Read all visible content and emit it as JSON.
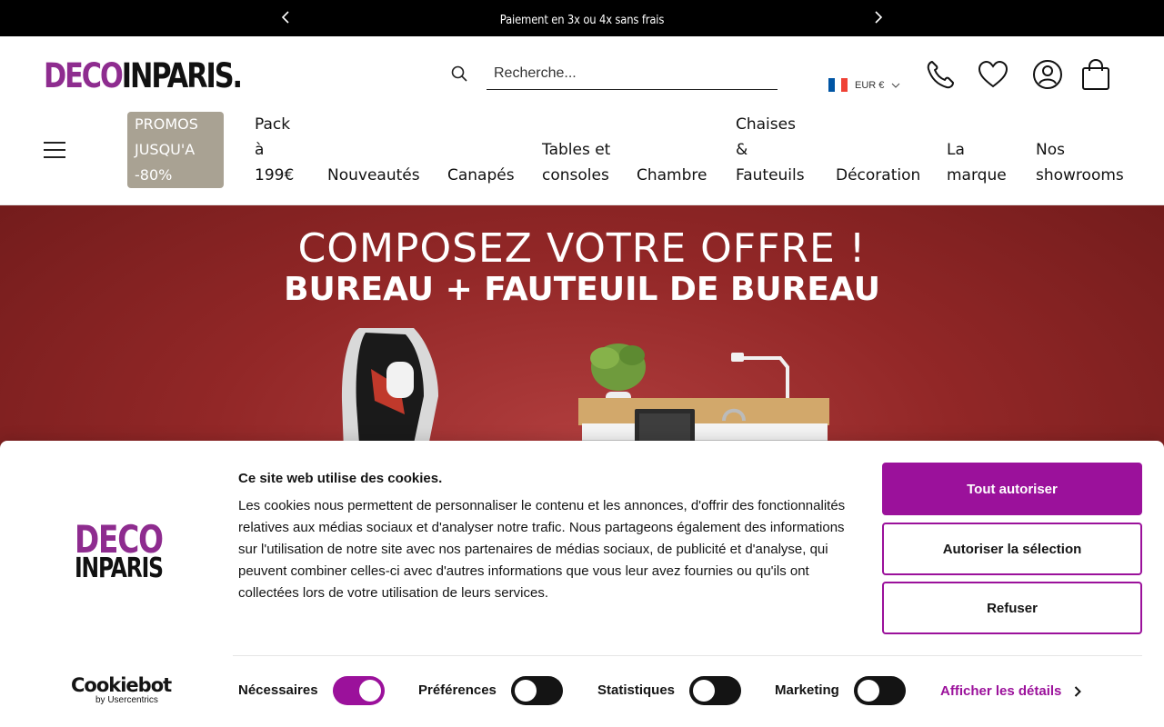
{
  "announcement": {
    "message": "Paiement en 3x ou 4x sans frais",
    "prev_icon": "chevron-left-icon",
    "next_icon": "chevron-right-icon"
  },
  "header": {
    "logo": {
      "part1": "DECO",
      "part2": "INPARIS",
      "dot": "."
    },
    "search": {
      "placeholder": "Recherche...",
      "value": ""
    },
    "currency": {
      "label": "EUR €",
      "flag": "france-flag"
    },
    "icons": [
      "phone-icon",
      "heart-icon",
      "account-icon",
      "cart-icon"
    ],
    "colors": {
      "brand": "#8e2c8f",
      "promo_bg": "#a9a293"
    }
  },
  "nav": {
    "menu_icon": "hamburger-icon",
    "promo": [
      "PROMOS",
      "JUSQU'A",
      "-80%"
    ],
    "pack": [
      "Pack",
      "à",
      "199€"
    ],
    "nouveautes": "Nouveautés",
    "canapes": "Canapés",
    "tables": [
      "Tables et",
      "consoles"
    ],
    "chambre": "Chambre",
    "chaises": [
      "Chaises",
      "&",
      "Fauteuils"
    ],
    "decoration": "Décoration",
    "marque": [
      "La",
      "marque"
    ],
    "showrooms": [
      "Nos",
      "showrooms"
    ]
  },
  "hero": {
    "line1": "COMPOSEZ VOTRE OFFRE !",
    "line2": "BUREAU + FAUTEUIL DE BUREAU",
    "background": "#922727"
  },
  "cookie": {
    "logo": {
      "line1": "DECO",
      "line2": "INPARIS"
    },
    "title": "Ce site web utilise des cookies.",
    "text": "Les cookies nous permettent de personnaliser le contenu et les annonces, d'offrir des fonctionnalités relatives aux médias sociaux et d'analyser notre trafic. Nous partageons également des informations sur l'utilisation de notre site avec nos partenaires de médias sociaux, de publicité et d'analyse, qui peuvent combiner celles-ci avec d'autres informations que vous leur avez fournies ou qu'ils ont collectées lors de votre utilisation de leurs services.",
    "buttons": {
      "allow_all": "Tout autoriser",
      "allow_selection": "Autoriser la sélection",
      "refuse": "Refuser"
    },
    "branding": {
      "name": "Cookiebot",
      "by": "by Usercentrics"
    },
    "toggles": [
      {
        "label": "Nécessaires",
        "state": "on"
      },
      {
        "label": "Préférences",
        "state": "off"
      },
      {
        "label": "Statistiques",
        "state": "off"
      },
      {
        "label": "Marketing",
        "state": "off"
      }
    ],
    "details_link": "Afficher les détails",
    "accent": "#9b119b"
  }
}
